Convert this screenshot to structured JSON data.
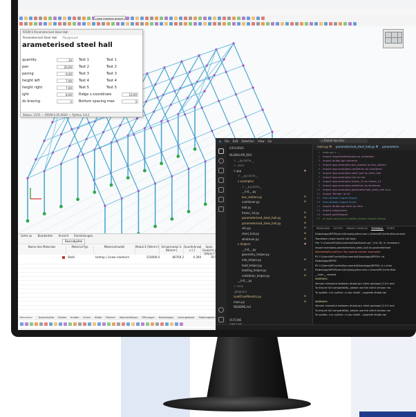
{
  "rfem": {
    "menubar": [
      "Datei",
      "Bearbeiten",
      "Ansicht",
      "Einfügen",
      "Zuweisen",
      "Berechnen",
      "Ergebnisse",
      "Extras",
      "Optionen",
      "Fenster",
      "CAD-BIM",
      "Hilfe"
    ],
    "load_case_dropdown": "Lineal Ergebnis Ansicht (Graph 1)",
    "dialog": {
      "title": "RFEM 6 Parameterised Steel Hall",
      "tabs": [
        "Parameterised Steel Hall",
        "Playground"
      ],
      "heading": "arameterised steel hall",
      "rows": [
        {
          "label": "quantity",
          "value": "10",
          "t1": "Text 1",
          "t2": "Text 1"
        },
        {
          "label": "pan",
          "value": "20.00",
          "t1": "Text 2",
          "t2": "Text 2"
        },
        {
          "label": "pacing",
          "value": "6.00",
          "t1": "Text 3",
          "t2": "Text 3"
        },
        {
          "label": "height left",
          "value": "7.00",
          "t1": "Text 4",
          "t2": "Text 4"
        },
        {
          "label": "height right",
          "value": "7.00",
          "t1": "Text 5",
          "t2": "Text 5"
        },
        {
          "label": "ight",
          "value": "8.00",
          "t1": "Ridge x-coordinate",
          "t2": "10.00"
        },
        {
          "label": "ds bracing",
          "value": "2",
          "t1": "Bottom spacing max",
          "t2": "3"
        }
      ],
      "status": "Status: 2155 — RFEM 6.05.0020 — Python 3.8.2"
    },
    "table": {
      "menu": [
        "Gehe zu",
        "Bearbeiten",
        "Ansicht",
        "Einstellungen"
      ],
      "dropdown": "Basisobjekte",
      "columns": [
        "Name des Materials",
        "Material-Typ",
        "Materialmodell",
        "Modul E [N/mm²]",
        "Schubmodul G [N/mm²]",
        "Querdehnzahl ν [-]",
        "Spez. Gewicht γ [kN/m³]"
      ],
      "row": [
        "",
        "Stahl",
        "Isotrop | Linear elastisch",
        "210000.0",
        "80769.2",
        "0.300",
        "78.50"
      ],
      "bottom_tabs": [
        "Materialien",
        "Querschnitte",
        "Dicken",
        "Knoten",
        "Linien",
        "Stäbe",
        "Flächen",
        "Volumenkörper",
        "Öffnungen",
        "Knotenlager",
        "Liniengelenke",
        "Stabendgelenke",
        "Schnitte"
      ]
    }
  },
  "vscode": {
    "menu": [
      "File",
      "Edit",
      "Selection",
      "View",
      "Go"
    ],
    "search": "Dlubal-Api-Dev",
    "sidebar_title": "EXPLORER",
    "tree": [
      {
        "text": "DLUBALAPI_DEV",
        "indent": 0,
        "color": "#cccccc"
      },
      {
        "text": "> __pycache__",
        "indent": 3,
        "color": "#8c8c8c"
      },
      {
        "text": "> .venv",
        "indent": 3,
        "color": "#8c8c8c"
      },
      {
        "text": "v app",
        "indent": 3,
        "color": "#cccccc",
        "badge": "●"
      },
      {
        "text": "> __pycache__",
        "indent": 6,
        "color": "#8c8c8c"
      },
      {
        "text": "v examples",
        "indent": 6,
        "color": "#e2c08d"
      },
      {
        "text": "> __pycache__",
        "indent": 9,
        "color": "#8c8c8c"
      },
      {
        "text": "__init__.py",
        "indent": 9,
        "color": "#cccccc"
      },
      {
        "text": "bus_station.py",
        "indent": 9,
        "color": "#e2c08d",
        "badge": "M"
      },
      {
        "text": "cantilever.py",
        "indent": 9,
        "color": "#cccccc",
        "badge": "M"
      },
      {
        "text": "hall.py",
        "indent": 9,
        "color": "#cccccc"
      },
      {
        "text": "frame_14.py",
        "indent": 9,
        "color": "#cccccc",
        "badge": "M"
      },
      {
        "text": "parameterised_steel_hall.py",
        "indent": 9,
        "color": "#e2c08d",
        "badge": "M"
      },
      {
        "text": "parameterised_steel_hall.py",
        "indent": 9,
        "color": "#e2c08d",
        "badge": "M"
      },
      {
        "text": "silo.py",
        "indent": 9,
        "color": "#cccccc",
        "badge": "M"
      },
      {
        "text": "steel_hall.py",
        "indent": 9,
        "color": "#cccccc",
        "badge": "M"
      },
      {
        "text": "whatever.py",
        "indent": 9,
        "color": "#cccccc",
        "badge": "M"
      },
      {
        "text": "v helpers",
        "indent": 6,
        "color": "#e2c08d",
        "badge": "●"
      },
      {
        "text": "__init__.py",
        "indent": 9,
        "color": "#cccccc"
      },
      {
        "text": "geometry_helper.py",
        "indent": 9,
        "color": "#cccccc"
      },
      {
        "text": "info_helper.py",
        "indent": 9,
        "color": "#cccccc",
        "badge": "M"
      },
      {
        "text": "load_helper.py",
        "indent": 9,
        "color": "#cccccc"
      },
      {
        "text": "loading_helper.py",
        "indent": 9,
        "color": "#cccccc",
        "badge": "M"
      },
      {
        "text": "validation_helper.py",
        "indent": 9,
        "color": "#cccccc",
        "badge": "M"
      },
      {
        "text": "__init__.py",
        "indent": 6,
        "color": "#cccccc"
      },
      {
        "text": "> venv",
        "indent": 3,
        "color": "#8c8c8c"
      },
      {
        "text": ".gitignore",
        "indent": 3,
        "color": "#8c8c8c"
      },
      {
        "text": "LoadCaseResults.py",
        "indent": 3,
        "color": "#e2c08d",
        "badge": "M"
      },
      {
        "text": "main.py",
        "indent": 3,
        "color": "#cccccc",
        "badge": "M"
      },
      {
        "text": "README.md",
        "indent": 3,
        "color": "#cccccc"
      }
    ],
    "outline": [
      "OUTLINE",
      "TIMELINE"
    ],
    "tabs": [
      "main.py M",
      "parameterised_steel_hall.py M",
      "parameteris"
    ],
    "code": [
      {
        "ln": "1",
        "text": "main.py > ...",
        "color": "#9d9d9d"
      },
      {
        "ln": "2",
        "text": "import ImportlibMetadata as metadata",
        "color": "#c586c0"
      },
      {
        "ln": "3",
        "text": "import dlubal.api.common",
        "color": "#c586c0"
      },
      {
        "ln": "4",
        "text": "import app.examples.bus_station as bus_station",
        "color": "#c586c0"
      },
      {
        "ln": "5",
        "text": "import app.examples.cantilever as cantilever",
        "color": "#c586c0"
      },
      {
        "ln": "6",
        "text": "import app.examples.steel_hall as steel_hall",
        "color": "#c586c0"
      },
      {
        "ln": "7",
        "text": "import app.examples.silo as silo",
        "color": "#c586c0"
      },
      {
        "ln": "8",
        "text": "import app.examples.frame_14 as frame_14",
        "color": "#c586c0"
      },
      {
        "ln": "9",
        "text": "import app.examples.whatever as whatever",
        "color": "#c586c0"
      },
      {
        "ln": "10",
        "text": "import app.examples.parameterised_steel_hall as p",
        "color": "#c586c0"
      },
      {
        "ln": "11",
        "text": "import 'blinker' as bl",
        "color": "#c586c0"
      },
      {
        "ln": "12",
        "text": "from blinker import Signal",
        "color": "#569cd6"
      },
      {
        "ln": "13",
        "text": "from blinker import Event",
        "color": "#569cd6"
      },
      {
        "ln": "14",
        "text": "import dlubal.api.rfem as rfem",
        "color": "#c586c0"
      },
      {
        "ln": "15",
        "text": "import subprocess",
        "color": "#c586c0"
      },
      {
        "ln": "16",
        "text": "import pathlibspod",
        "color": "#c586c0"
      },
      {
        "ln": "17",
        "text": "# make api-server healthy before import Dlubal",
        "color": "#6a9955"
      }
    ],
    "terminal_tabs": [
      "PROBLEMS",
      "OUTPUT",
      "DEBUG CONSOLE",
      "TERMINAL",
      "PORTS"
    ],
    "terminal": [
      {
        "text": "Dlubal\\app\\RFEM\\venv\\Scripts\\python.exe c:/Users/MC/rsrfm/Documents",
        "color": "#d4d4d4"
      },
      {
        "text": "Traceback (most recent call last):",
        "color": "#d4d4d4"
      },
      {
        "text": "  File \"c:\\Users\\MC\\Documents\\Dlubal\\main.py\", line 18, in <module>",
        "color": "#d4d4d4"
      },
      {
        "text": "    import examples.parameterised_steel_hall as parameterised",
        "color": "#d4d4d4"
      },
      {
        "text": "ModuleNotFoundError: No module named 'examples'",
        "color": "#f48771"
      },
      {
        "text": "PS C:\\Users\\MC\\rsrfm\\Documents\\Dlubal\\app\\RFEM> cd",
        "color": "#d4d4d4"
      },
      {
        "text": "Dlubal\\app\\RFEM",
        "color": "#d4d4d4"
      },
      {
        "text": "PS C:\\Users\\MC\\rsrfm\\Documents\\Dlubal\\app\\RFEM> & c:/Use",
        "color": "#d4d4d4"
      },
      {
        "text": "Dlubal\\app\\RFEM\\venv\\Scripts\\python.exe c:/Users/MC/rsrfm/Doc",
        "color": "#d4d4d4"
      },
      {
        "text": "__main__ started",
        "color": "#d4d4d4"
      },
      {
        "text": "WARNING:",
        "color": "#dcdcaa"
      },
      {
        "text": "Version mismatch between dlubal.api client package (2.0.0 and",
        "color": "#d4d4d4"
      },
      {
        "text": "To ensure full compatibility, please use the client version ma",
        "color": "#d4d4d4"
      },
      {
        "text": "To update, run: python -m pip install --upgrade dlubal.api",
        "color": "#d4d4d4"
      },
      {
        "text": "",
        "color": "#d4d4d4"
      },
      {
        "text": "WARNING:",
        "color": "#dcdcaa"
      },
      {
        "text": "Version mismatch between dlubal.api client package (2.0.0 and",
        "color": "#d4d4d4"
      },
      {
        "text": "To ensure full compatibility, please use the client version ma",
        "color": "#d4d4d4"
      },
      {
        "text": "To update, run: python -m pip install --upgrade dlubal.api",
        "color": "#d4d4d4"
      }
    ]
  }
}
